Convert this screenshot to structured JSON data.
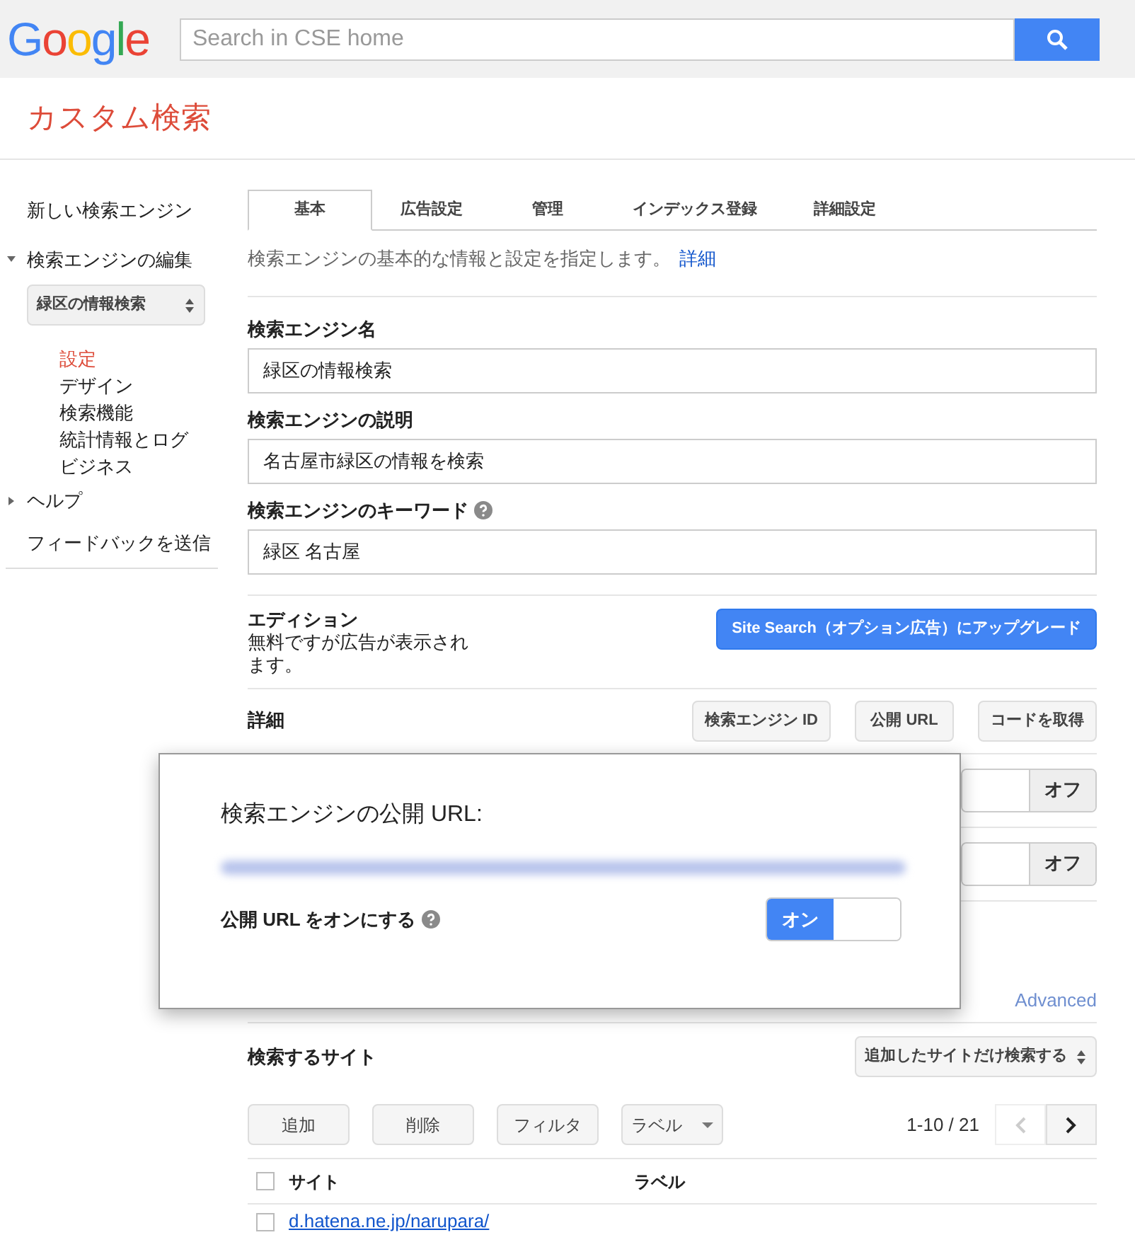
{
  "header": {
    "logo": "Google",
    "search": {
      "placeholder": "Search in CSE home"
    }
  },
  "page_title": "カスタム検索",
  "sidebar": {
    "items": [
      {
        "kind": "link",
        "label": "新しい検索エンジン"
      },
      {
        "kind": "section",
        "label": "検索エンジンの編集",
        "expanded": true,
        "engine_select": "緑区の情報検索",
        "children": [
          {
            "label": "設定",
            "selected": true
          },
          {
            "label": "デザイン",
            "selected": false
          },
          {
            "label": "検索機能",
            "selected": false
          },
          {
            "label": "統計情報とログ",
            "selected": false
          },
          {
            "label": "ビジネス",
            "selected": false
          }
        ]
      },
      {
        "kind": "section",
        "label": "ヘルプ",
        "expanded": false
      },
      {
        "kind": "link",
        "label": "フィードバックを送信"
      }
    ]
  },
  "tabs": [
    {
      "label": "基本",
      "selected": true
    },
    {
      "label": "広告設定",
      "selected": false
    },
    {
      "label": "管理",
      "selected": false
    },
    {
      "label": "インデックス登録",
      "selected": false
    },
    {
      "label": "詳細設定",
      "selected": false
    }
  ],
  "intro": {
    "text": "検索エンジンの基本的な情報と設定を指定します。",
    "link": "詳細"
  },
  "fields": [
    {
      "label": "検索エンジン名",
      "value": "緑区の情報検索"
    },
    {
      "label": "検索エンジンの説明",
      "value": "名古屋市緑区の情報を検索"
    },
    {
      "label": "検索エンジンのキーワード",
      "value": "緑区 名古屋",
      "help": true
    }
  ],
  "edition": {
    "label": "エディション",
    "text": "無料ですが広告が表示されます。",
    "upgrade_button": "Site Search（オプション広告）にアップグレード"
  },
  "details": {
    "label": "詳細",
    "buttons": [
      "検索エンジン ID",
      "公開 URL",
      "コードを取得"
    ]
  },
  "toggle_rows": [
    {
      "on": false,
      "label": "オフ"
    },
    {
      "on": false,
      "label": "オフ"
    }
  ],
  "advanced_link": "Advanced",
  "sites": {
    "title": "検索するサイト",
    "scope_select": "追加したサイトだけ検索する",
    "buttons": [
      {
        "kind": "button",
        "label": "追加"
      },
      {
        "kind": "button",
        "label": "削除"
      },
      {
        "kind": "button",
        "label": "フィルタ"
      },
      {
        "kind": "dropdown",
        "label": "ラベル"
      }
    ],
    "pagination": {
      "range": "1-10 / 21",
      "prev_disabled": true
    },
    "columns": [
      "サイト",
      "ラベル"
    ],
    "all_checked": false,
    "rows": [
      {
        "site": "d.hatena.ne.jp/narupara/",
        "checked": false
      }
    ]
  },
  "modal": {
    "title": "検索エンジンの公開 URL:",
    "setting_label": "公開 URL をオンにする",
    "help": true,
    "toggle": {
      "on": true,
      "label": "オン"
    }
  }
}
